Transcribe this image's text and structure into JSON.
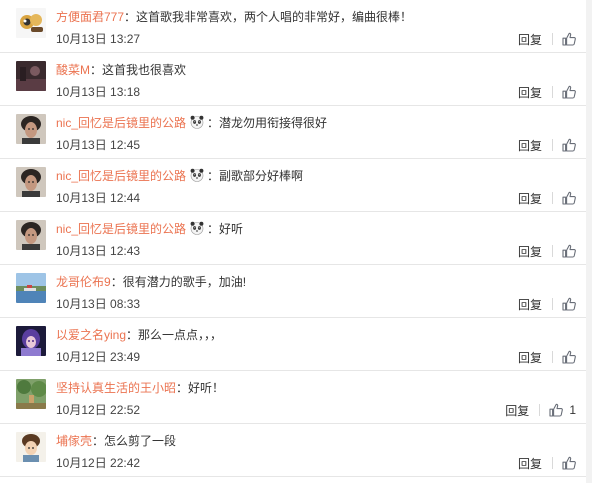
{
  "comments": [
    {
      "user": "方便面君777",
      "text": "这首歌我非常喜欢，两个人唱的非常好，编曲很棒！",
      "time": "10月13日 13:27",
      "reply": "回复",
      "like": "",
      "avatar": "raccoon-avatar",
      "emoji": false
    },
    {
      "user": "酸菜M",
      "text": "这首我也很喜欢",
      "time": "10月13日 13:18",
      "reply": "回复",
      "like": "",
      "avatar": "dark-photo-avatar",
      "emoji": false
    },
    {
      "user": "nic_回忆是后镜里的公路",
      "text": "潜龙勿用衔接得很好",
      "time": "10月13日 12:45",
      "reply": "回复",
      "like": "",
      "avatar": "portrait-avatar",
      "emoji": true
    },
    {
      "user": "nic_回忆是后镜里的公路",
      "text": "副歌部分好棒啊",
      "time": "10月13日 12:44",
      "reply": "回复",
      "like": "",
      "avatar": "portrait-avatar",
      "emoji": true
    },
    {
      "user": "nic_回忆是后镜里的公路",
      "text": "好听",
      "time": "10月13日 12:43",
      "reply": "回复",
      "like": "",
      "avatar": "portrait-avatar",
      "emoji": true
    },
    {
      "user": "龙哥伦布9",
      "text": "很有潜力的歌手，加油!",
      "time": "10月13日 08:33",
      "reply": "回复",
      "like": "",
      "avatar": "landscape-avatar",
      "emoji": false
    },
    {
      "user": "以爱之名ying",
      "text": "那么一点点，，，",
      "time": "10月12日 23:49",
      "reply": "回复",
      "like": "",
      "avatar": "anime-avatar",
      "emoji": false
    },
    {
      "user": "坚持认真生活的王小昭",
      "text": "好听！",
      "time": "10月12日 22:52",
      "reply": "回复",
      "like": "1",
      "avatar": "nature-avatar",
      "emoji": false
    },
    {
      "user": "埔傢壳",
      "text": "怎么剪了一段",
      "time": "10月12日 22:42",
      "reply": "回复",
      "like": "",
      "avatar": "cartoon-avatar",
      "emoji": false
    }
  ],
  "emoji_icon": "panda-emoji-icon",
  "like_icon": "thumbs-up-icon",
  "colors": {
    "username": "#eb7350",
    "text": "#333333",
    "divider": "#e6e6e6"
  }
}
